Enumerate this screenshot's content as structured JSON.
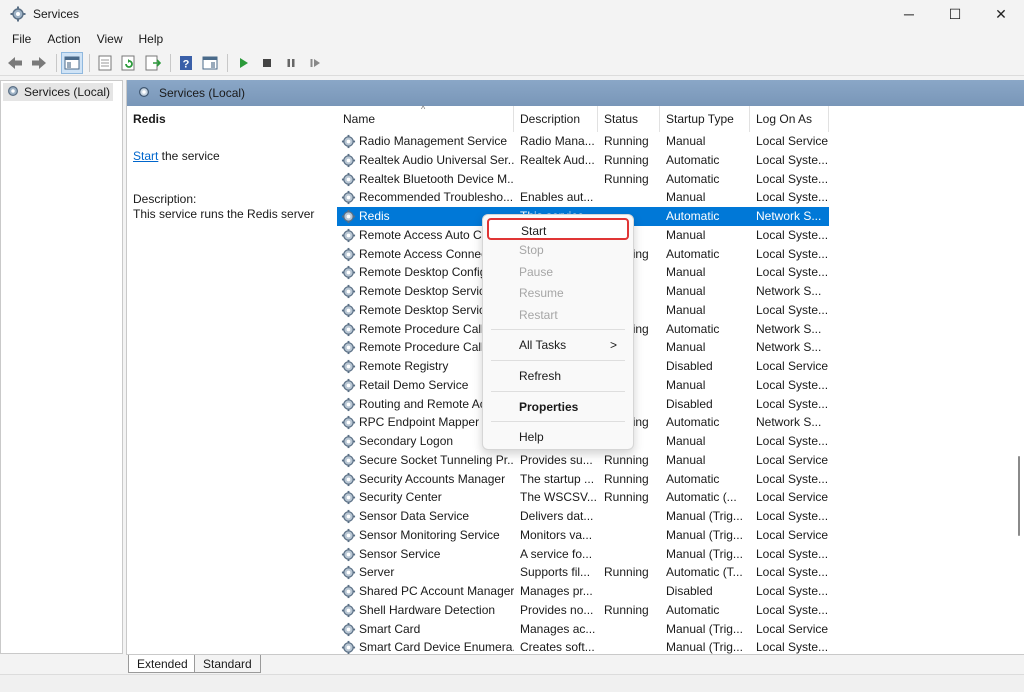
{
  "window": {
    "title": "Services",
    "controls": [
      "─",
      "☐",
      "✕"
    ]
  },
  "menubar": [
    "File",
    "Action",
    "View",
    "Help"
  ],
  "tree": {
    "root_label": "Services (Local)"
  },
  "right_header": "Services (Local)",
  "description_pane": {
    "service_name": "Redis",
    "start_link": "Start",
    "start_suffix": " the service",
    "description_label": "Description:",
    "description_text": "This service runs the Redis server"
  },
  "columns": [
    "Name",
    "Description",
    "Status",
    "Startup Type",
    "Log On As"
  ],
  "services": [
    [
      "Radio Management Service",
      "Radio Mana...",
      "Running",
      "Manual",
      "Local Service"
    ],
    [
      "Realtek Audio Universal Ser...",
      "Realtek Aud...",
      "Running",
      "Automatic",
      "Local Syste..."
    ],
    [
      "Realtek Bluetooth Device M...",
      "",
      "Running",
      "Automatic",
      "Local Syste..."
    ],
    [
      "Recommended Troublesho...",
      "Enables aut...",
      "",
      "Manual",
      "Local Syste..."
    ],
    [
      "Redis",
      "This service...",
      "",
      "Automatic",
      "Network S..."
    ],
    [
      "Remote Access Auto Co",
      "",
      "",
      "Manual",
      "Local Syste..."
    ],
    [
      "Remote Access Connect",
      "",
      "Running",
      "Automatic",
      "Local Syste..."
    ],
    [
      "Remote Desktop Config",
      "",
      "",
      "Manual",
      "Local Syste..."
    ],
    [
      "Remote Desktop Service",
      "",
      "",
      "Manual",
      "Network S..."
    ],
    [
      "Remote Desktop Service",
      "",
      "",
      "Manual",
      "Local Syste..."
    ],
    [
      "Remote Procedure Call",
      "",
      "Running",
      "Automatic",
      "Network S..."
    ],
    [
      "Remote Procedure Call",
      "",
      "",
      "Manual",
      "Network S..."
    ],
    [
      "Remote Registry",
      "",
      "",
      "Disabled",
      "Local Service"
    ],
    [
      "Retail Demo Service",
      "",
      "",
      "Manual",
      "Local Syste..."
    ],
    [
      "Routing and Remote Ac",
      "",
      "",
      "Disabled",
      "Local Syste..."
    ],
    [
      "RPC Endpoint Mapper",
      "",
      "Running",
      "Automatic",
      "Network S..."
    ],
    [
      "Secondary Logon",
      "",
      "",
      "Manual",
      "Local Syste..."
    ],
    [
      "Secure Socket Tunneling Pr...",
      "Provides su...",
      "Running",
      "Manual",
      "Local Service"
    ],
    [
      "Security Accounts Manager",
      "The startup ...",
      "Running",
      "Automatic",
      "Local Syste..."
    ],
    [
      "Security Center",
      "The WSCSV...",
      "Running",
      "Automatic (...",
      "Local Service"
    ],
    [
      "Sensor Data Service",
      "Delivers dat...",
      "",
      "Manual (Trig...",
      "Local Syste..."
    ],
    [
      "Sensor Monitoring Service",
      "Monitors va...",
      "",
      "Manual (Trig...",
      "Local Service"
    ],
    [
      "Sensor Service",
      "A service fo...",
      "",
      "Manual (Trig...",
      "Local Syste..."
    ],
    [
      "Server",
      "Supports fil...",
      "Running",
      "Automatic (T...",
      "Local Syste..."
    ],
    [
      "Shared PC Account Manager",
      "Manages pr...",
      "",
      "Disabled",
      "Local Syste..."
    ],
    [
      "Shell Hardware Detection",
      "Provides no...",
      "Running",
      "Automatic",
      "Local Syste..."
    ],
    [
      "Smart Card",
      "Manages ac...",
      "",
      "Manual (Trig...",
      "Local Service"
    ],
    [
      "Smart Card Device Enumera...",
      "Creates soft...",
      "",
      "Manual (Trig...",
      "Local Syste..."
    ]
  ],
  "selected_service": "Redis",
  "context_menu": {
    "items": [
      {
        "label": "Start",
        "state": "enabled"
      },
      {
        "label": "Stop",
        "state": "disabled"
      },
      {
        "label": "Pause",
        "state": "disabled"
      },
      {
        "label": "Resume",
        "state": "disabled"
      },
      {
        "label": "Restart",
        "state": "disabled"
      },
      {
        "label": "All Tasks",
        "state": "enabled",
        "arrow": ">"
      },
      {
        "label": "Refresh",
        "state": "enabled"
      },
      {
        "label": "Properties",
        "state": "enabled"
      },
      {
        "label": "Help",
        "state": "enabled"
      }
    ]
  },
  "bottom_tabs": [
    "Extended",
    "Standard"
  ],
  "colors": {
    "selection": "#0078d7",
    "highlight_border": "#e03535",
    "header_gradient": "#8aa7c7",
    "link": "#0066cc"
  }
}
